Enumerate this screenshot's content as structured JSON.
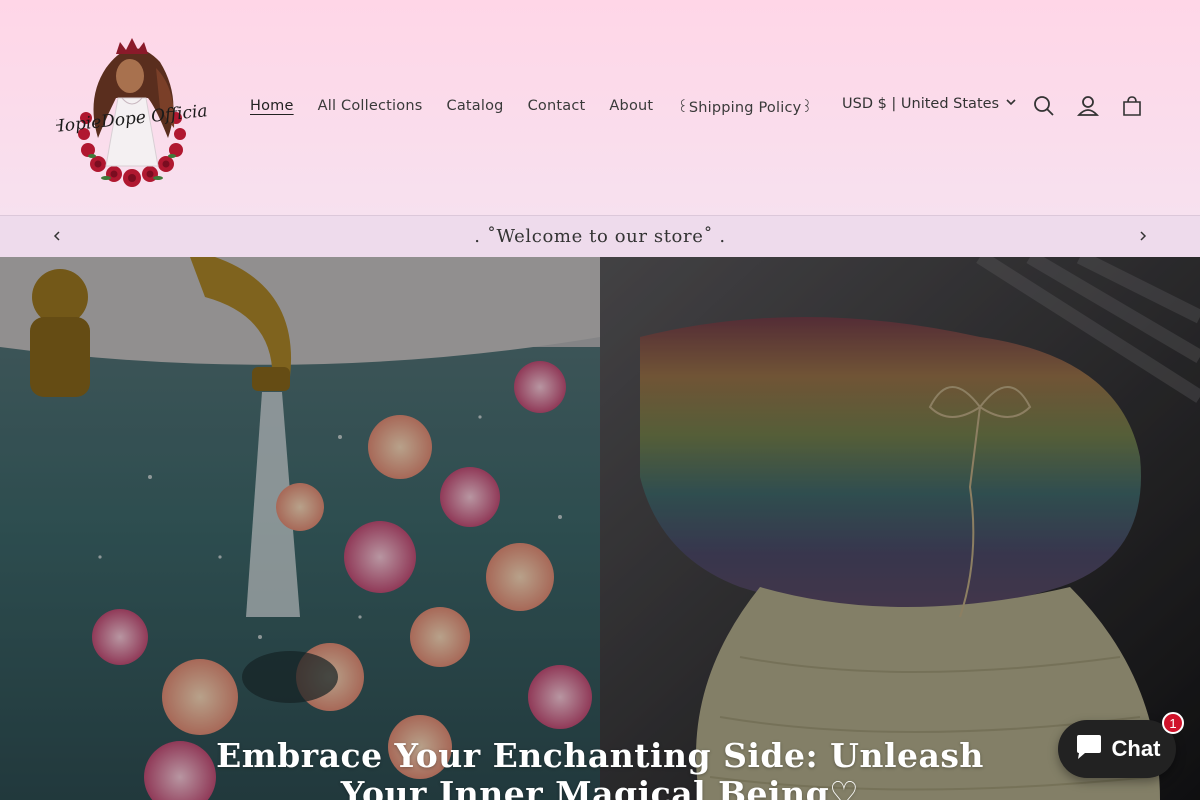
{
  "header": {
    "logo_text": "HopieDope Official",
    "nav": [
      {
        "label": "Home",
        "active": true
      },
      {
        "label": "All Collections",
        "active": false
      },
      {
        "label": "Catalog",
        "active": false
      },
      {
        "label": "Contact",
        "active": false
      },
      {
        "label": "About",
        "active": false
      },
      {
        "label": "꒰Shipping Policy꒱",
        "active": false
      }
    ],
    "currency": "USD $ | United States",
    "icons": [
      "search-icon",
      "account-icon",
      "cart-icon"
    ]
  },
  "announcement": {
    "text": ".  ˚Welcome to our store˚  ."
  },
  "hero": {
    "heading": "Embrace Your Enchanting Side: Unleash Your Inner Magical Being♡"
  },
  "chat": {
    "label": "Chat",
    "badge_count": "1"
  },
  "colors": {
    "header_bg": "#ffd6e7",
    "announcement_bg": "#eedbec",
    "chat_bg": "#222222",
    "badge": "#d0122a"
  }
}
